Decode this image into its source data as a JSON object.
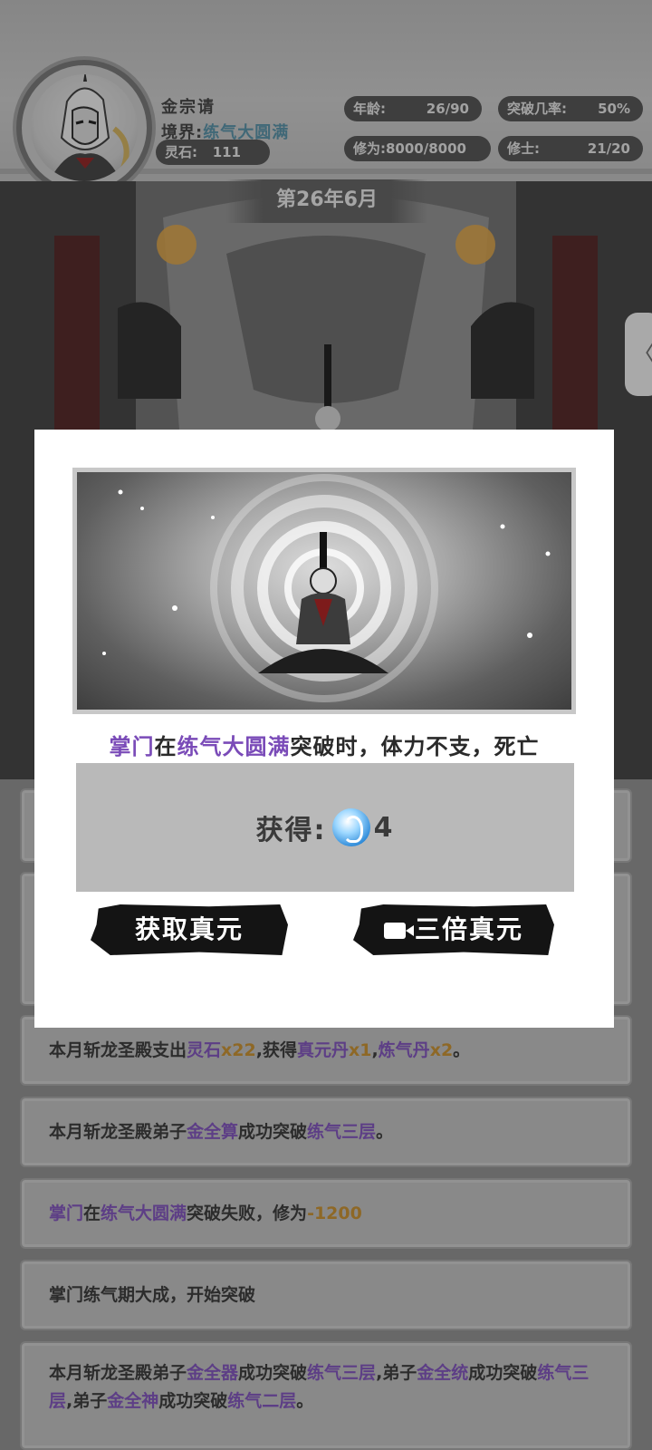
{
  "header": {
    "leader_name": "金宗请",
    "realm_label": "境界:",
    "realm_value": "练气大圆满",
    "spirit_stone_label": "灵石:",
    "spirit_stone_value": "111",
    "age_label": "年龄:",
    "age_value": "26/90",
    "breakthrough_label": "突破几率:",
    "breakthrough_value": "50%",
    "cultivation_label": "修为:",
    "cultivation_value": "8000/8000",
    "disciples_label": "修士:",
    "disciples_value": "21/20"
  },
  "date_banner": "第26年6月",
  "side_tab_glyph": "〈",
  "modal": {
    "message_parts": [
      "掌门",
      "在",
      "练气大圆满",
      "突破时，体力不支，死亡"
    ],
    "reward_label": "获得:",
    "reward_amount": "4",
    "get_button": "获取真元",
    "triple_button": "三倍真元"
  },
  "log": [
    {
      "parts": [
        "本月斩龙圣殿支出",
        "灵石",
        "x22",
        ",获得",
        "真元丹",
        "x1",
        ",",
        "炼气丹",
        "x2",
        "。"
      ]
    },
    {
      "parts": [
        "本月斩龙圣殿弟子",
        "金全算",
        "成功突破",
        "练气三层",
        "。"
      ]
    },
    {
      "parts": [
        "掌门",
        "在",
        "练气大圆满",
        "突破失败，修为",
        "-1200"
      ]
    },
    {
      "parts": [
        "掌门练气期大成，开始突破"
      ]
    },
    {
      "parts": [
        "本月斩龙圣殿弟子",
        "金全器",
        "成功突破",
        "练气三层",
        ",弟子",
        "金全统",
        "成功突破",
        "练气三层",
        ",弟子",
        "金全神",
        "成功突破",
        "练气二层",
        "。"
      ]
    }
  ]
}
